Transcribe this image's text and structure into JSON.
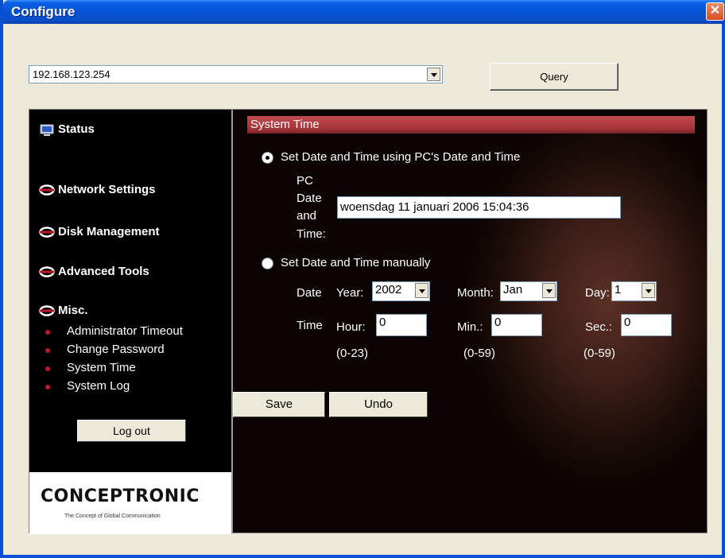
{
  "window": {
    "title": "Configure",
    "close_glyph": "✕"
  },
  "toolbar": {
    "ip_value": "192.168.123.254",
    "query_label": "Query"
  },
  "sidebar": {
    "status": "Status",
    "network": "Network Settings",
    "disk": "Disk Management",
    "advanced": "Advanced Tools",
    "misc": "Misc.",
    "misc_items": [
      "Administrator Timeout",
      "Change Password",
      "System Time",
      "System Log"
    ],
    "logout_label": "Log out",
    "logo_text": "CONCEPTRONIC",
    "logo_tagline": "The Concept of Global Communication"
  },
  "main": {
    "section_title": "System Time",
    "opt_pc": "Set Date and Time using PC's Date and Time",
    "pc_label_1": "PC",
    "pc_label_2": "Date",
    "pc_label_3": "and",
    "pc_label_4": "Time:",
    "pc_datetime": "woensdag 11 januari 2006 15:04:36",
    "opt_manual": "Set Date and Time manually",
    "date_label": "Date",
    "year_label": "Year:",
    "year_value": "2002",
    "month_label": "Month:",
    "month_value": "Jan",
    "day_label": "Day:",
    "day_value": "1",
    "time_label": "Time",
    "hour_label": "Hour:",
    "hour_value": "0",
    "min_label": "Min.:",
    "min_value": "0",
    "sec_label": "Sec.:",
    "sec_value": "0",
    "hour_range": "(0-23)",
    "min_range": "(0-59)",
    "sec_range": "(0-59)",
    "save_label": "Save",
    "undo_label": "Undo"
  },
  "colors": {
    "titlebar": "#0553d6",
    "section_bar": "#a8353a",
    "bullet": "#c0172d"
  }
}
